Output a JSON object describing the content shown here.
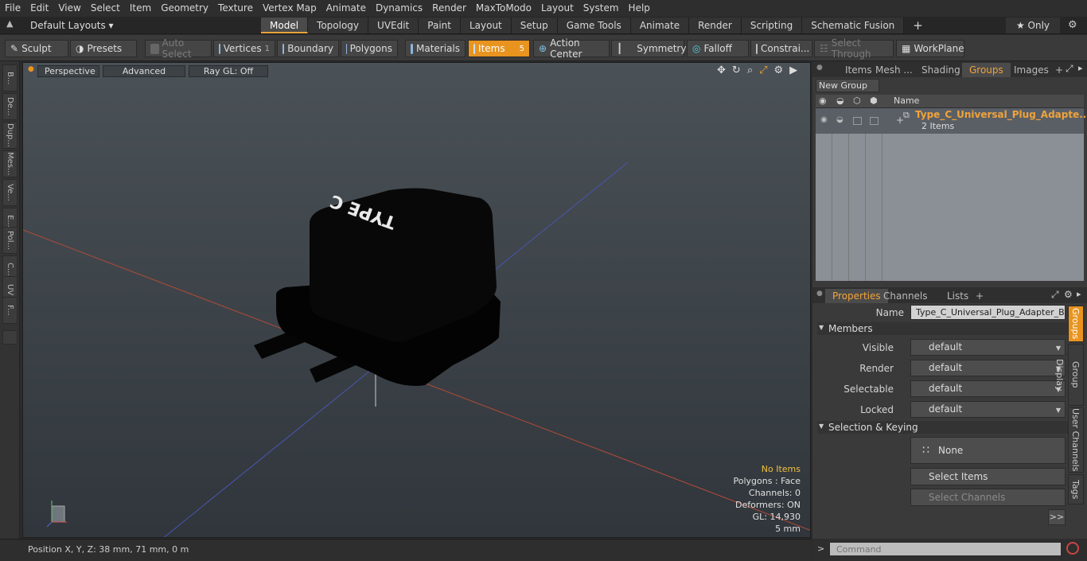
{
  "menu": [
    "File",
    "Edit",
    "View",
    "Select",
    "Item",
    "Geometry",
    "Texture",
    "Vertex Map",
    "Animate",
    "Dynamics",
    "Render",
    "MaxToModo",
    "Layout",
    "System",
    "Help"
  ],
  "layout_selector": "Default Layouts ▾",
  "mode_tabs": [
    {
      "label": "Model",
      "active": true
    },
    {
      "label": "Topology"
    },
    {
      "label": "UVEdit"
    },
    {
      "label": "Paint"
    },
    {
      "label": "Layout"
    },
    {
      "label": "Setup"
    },
    {
      "label": "Game Tools"
    },
    {
      "label": "Animate"
    },
    {
      "label": "Render"
    },
    {
      "label": "Scripting"
    },
    {
      "label": "Schematic Fusion"
    },
    {
      "label": "+"
    }
  ],
  "only_label": "★ Only",
  "toolbar": {
    "sculpt": "Sculpt",
    "presets": "Presets",
    "auto_select": "Auto Select",
    "vertices": "Vertices",
    "vertices_count": "1",
    "boundary": "Boundary",
    "polygons": "Polygons",
    "materials": "Materials",
    "items": "Items",
    "items_count": "5",
    "action_center": "Action Center",
    "symmetry": "Symmetry",
    "falloff": "Falloff",
    "constraints": "Constrai...",
    "select_through": "Select Through",
    "workplane": "WorkPlane"
  },
  "left_tabs": [
    "B...",
    "De...",
    "Dup...",
    "Mes...",
    "Ve...",
    "E...",
    "Pol...",
    "C...",
    "UV",
    "F..."
  ],
  "viewport": {
    "perspective": "Perspective",
    "advanced": "Advanced",
    "raygl": "Ray GL: Off",
    "label_text": "TYPE C",
    "stats": {
      "items": "No Items",
      "polygons": "Polygons : Face",
      "channels": "Channels: 0",
      "deformers": "Deformers: ON",
      "gl": "GL: 14,930",
      "scale": "5 mm"
    }
  },
  "status": {
    "position": "Position X, Y, Z:   38 mm, 71 mm, 0 m"
  },
  "panel_tabs": [
    {
      "label": "Items"
    },
    {
      "label": "Mesh ..."
    },
    {
      "label": "Shading"
    },
    {
      "label": "Groups",
      "active": true
    },
    {
      "label": "Images"
    },
    {
      "label": "+"
    }
  ],
  "groups": {
    "new_group": "New Group",
    "name_header": "Name",
    "item_name": "Type_C_Universal_Plug_Adapte...",
    "item_sub": "2 Items"
  },
  "prop_tabs": [
    {
      "label": "Properties",
      "active": true
    },
    {
      "label": "Channels"
    },
    {
      "label": "Lists"
    },
    {
      "label": "+"
    }
  ],
  "properties": {
    "name_label": "Name",
    "name_value": "Type_C_Universal_Plug_Adapter_Blac",
    "members": "Members",
    "visible_label": "Visible",
    "visible": "default",
    "render_label": "Render",
    "render": "default",
    "selectable_label": "Selectable",
    "selectable": "default",
    "locked_label": "Locked",
    "locked": "default",
    "sel_keying": "Selection & Keying",
    "none": "None",
    "select_items": "Select Items",
    "select_channels": "Select Channels",
    "more": ">>"
  },
  "side_tabs": [
    {
      "label": "Groups",
      "active": true
    },
    {
      "label": "Group Display"
    },
    {
      "label": "User Channels"
    },
    {
      "label": "Tags"
    }
  ],
  "command": {
    "prompt": ">",
    "placeholder": "Command"
  },
  "colors": {
    "accent": "#e8941f",
    "active_text": "#f0a33a"
  }
}
